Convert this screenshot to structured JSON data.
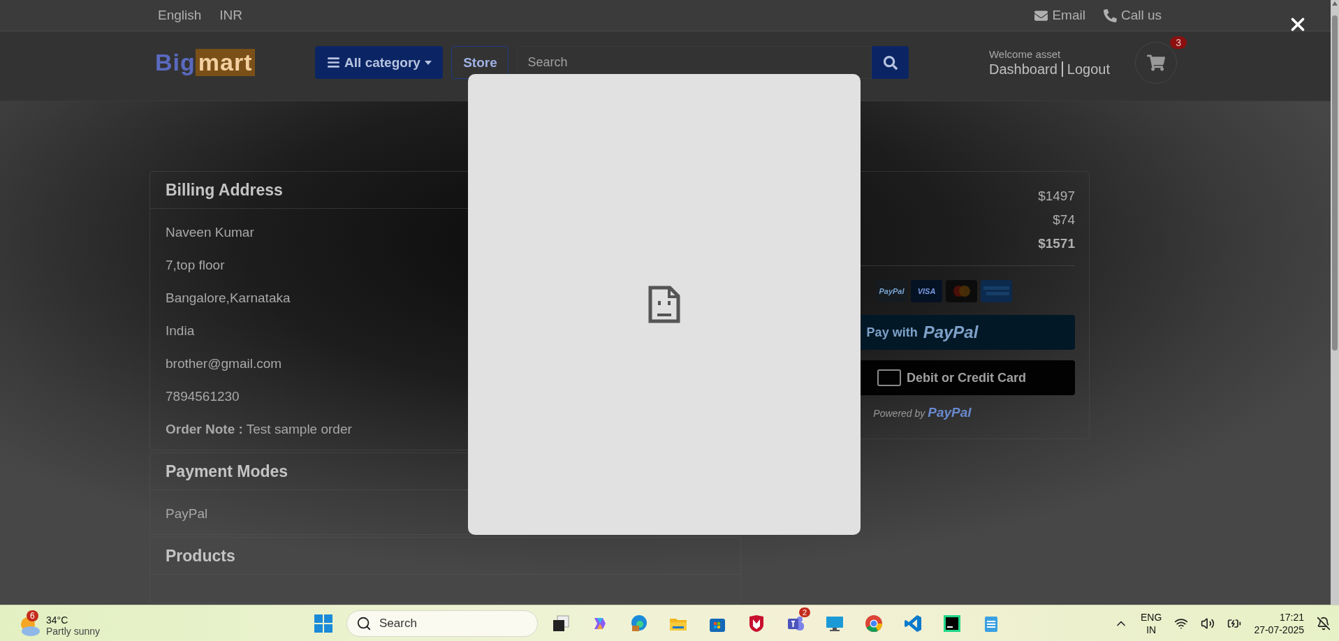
{
  "top_bar": {
    "left": [
      "English",
      "INR"
    ],
    "right": [
      {
        "kind": "email",
        "label": "Email"
      },
      {
        "kind": "phone",
        "label": "Call us"
      }
    ]
  },
  "header": {
    "logo": {
      "first": "Big",
      "second": "mart"
    },
    "category_button": "All category",
    "store_button": "Store",
    "search": {
      "placeholder": "Search"
    },
    "welcome": "Welcome asset",
    "links": [
      "Dashboard",
      "Logout"
    ],
    "cart_count": "3"
  },
  "billing": {
    "title": "Billing Address",
    "lines": [
      "Naveen Kumar",
      "7,top floor",
      "Bangalore,Karnataka",
      "India",
      "brother@gmail.com",
      "7894561230"
    ],
    "order_note": {
      "label": "Order Note :",
      "value": "Test sample order"
    }
  },
  "payment_modes": {
    "title": "Payment Modes",
    "value": "PayPal"
  },
  "products": {
    "title": "Products"
  },
  "summary": {
    "amounts": [
      {
        "value": "$1497",
        "bold": false
      },
      {
        "value": "$74",
        "bold": false
      },
      {
        "value": "$1571",
        "bold": true
      }
    ],
    "card_logos": [
      {
        "kind": "paypal",
        "label": "PayPal"
      },
      {
        "kind": "visa",
        "label": "VISA"
      },
      {
        "kind": "mastercard"
      },
      {
        "kind": "amex"
      }
    ],
    "pay_button": {
      "prefix": "Pay with",
      "brand": "PayPal"
    },
    "card_button": "Debit or Credit Card",
    "powered": {
      "prefix": "Powered by",
      "brand": "PayPal"
    }
  },
  "taskbar": {
    "weather": {
      "badge": "6",
      "temp": "34°C",
      "condition": "Partly sunny"
    },
    "search": {
      "placeholder": "Search"
    },
    "apps": [
      {
        "kind": "taskview"
      },
      {
        "kind": "copilot"
      },
      {
        "kind": "edge"
      },
      {
        "kind": "files"
      },
      {
        "kind": "store"
      },
      {
        "kind": "shield"
      },
      {
        "kind": "teams",
        "badge": "2"
      },
      {
        "kind": "monitor"
      },
      {
        "kind": "chrome"
      },
      {
        "kind": "vscode"
      },
      {
        "kind": "pycharm"
      },
      {
        "kind": "notepad"
      }
    ],
    "tray": {
      "lang": "ENG",
      "region": "IN",
      "time": "17:21",
      "date": "27-07-2025"
    }
  }
}
